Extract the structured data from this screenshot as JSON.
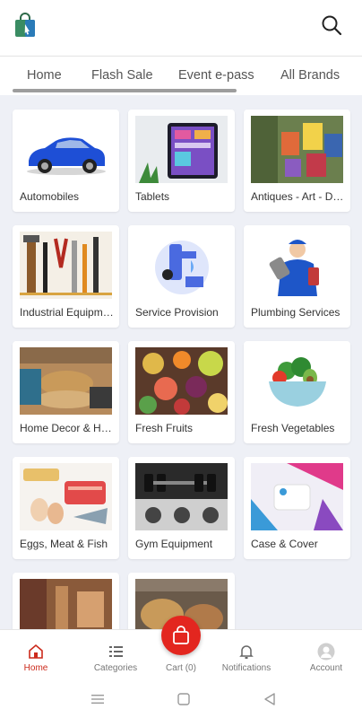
{
  "tabs": [
    "Home",
    "Flash Sale",
    "Event e-pass",
    "All Brands"
  ],
  "categories": [
    {
      "label": "Automobiles"
    },
    {
      "label": "Tablets"
    },
    {
      "label": "Antiques - Art - Decor"
    },
    {
      "label": "Industrial Equipment"
    },
    {
      "label": "Service Provision"
    },
    {
      "label": "Plumbing Services"
    },
    {
      "label": "Home Decor & Household"
    },
    {
      "label": "Fresh Fruits"
    },
    {
      "label": "Fresh Vegetables"
    },
    {
      "label": "Eggs, Meat & Fish"
    },
    {
      "label": "Gym Equipment"
    },
    {
      "label": "Case & Cover"
    },
    {
      "label": ""
    },
    {
      "label": ""
    }
  ],
  "bottom_nav": {
    "home": "Home",
    "categories": "Categories",
    "cart": "Cart (0)",
    "notifications": "Notifications",
    "account": "Account"
  },
  "colors": {
    "accent": "#e3261f",
    "active_label": "#cc2a1c",
    "page_bg": "#eef0f6"
  }
}
